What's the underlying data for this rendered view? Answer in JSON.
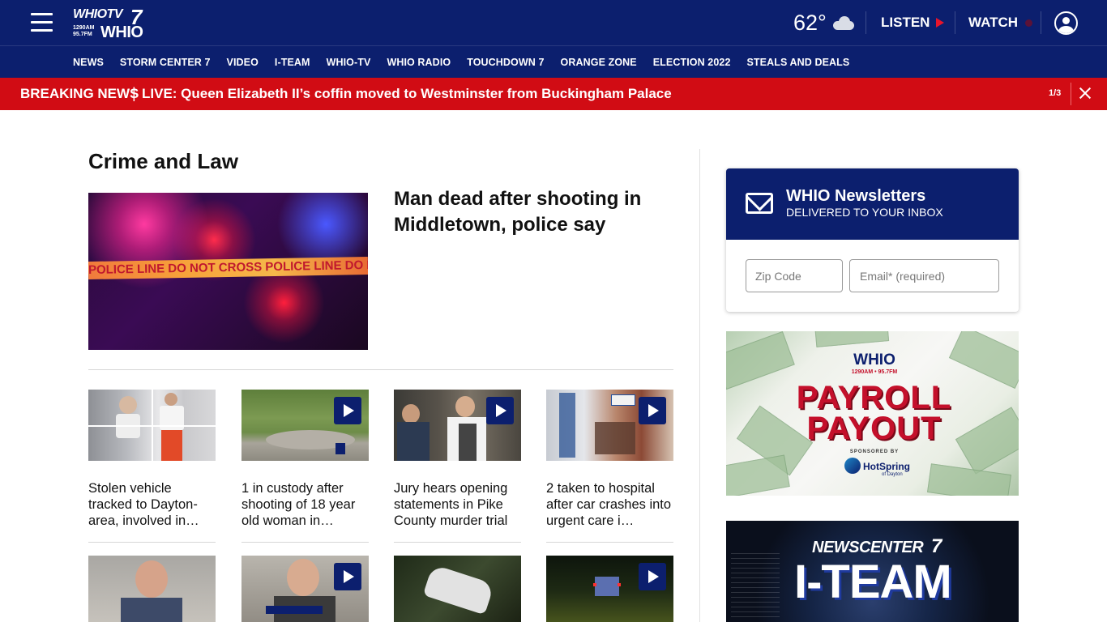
{
  "header": {
    "logo_line1": "WHIOTV",
    "logo_line1_num": "7",
    "logo_freq": "1290AM\n95.7FM",
    "logo_line2": "WHIO",
    "menu_icon": "hamburger-icon",
    "weather": {
      "temperature": "62°",
      "icon": "partly-cloudy-icon"
    },
    "listen_label": "LISTEN",
    "watch_label": "WATCH",
    "account_icon": "user-account-icon"
  },
  "nav": {
    "items": [
      "NEWS",
      "STORM CENTER 7",
      "VIDEO",
      "I-TEAM",
      "WHIO-TV",
      "WHIO RADIO",
      "TOUCHDOWN 7",
      "ORANGE ZONE",
      "ELECTION 2022",
      "STEALS AND DEALS"
    ]
  },
  "breaking": {
    "label": "BREAKING NEWS",
    "separator": "|",
    "headline": "LIVE: Queen Elizabeth II’s coffin moved to Westminster from Buckingham Palace",
    "counter": "1/3"
  },
  "section": {
    "title": "Crime and Law",
    "lead": {
      "title": "Man dead after shooting in Middletown, police say",
      "image_tape_text": "POLICE LINE DO NOT CROSS  POLICE LINE DO NOT CROSS"
    },
    "cards": [
      {
        "title": "Stolen vehicle tracked to Dayton-area, involved in…",
        "video": false
      },
      {
        "title": "1 in custody after shooting of 18 year old woman in…",
        "video": true
      },
      {
        "title": "Jury hears opening statements in Pike County murder trial",
        "video": true
      },
      {
        "title": "2 taken to hospital after car crashes into urgent care i…",
        "video": true
      },
      {
        "title": "",
        "video": false
      },
      {
        "title": "",
        "video": true
      },
      {
        "title": "",
        "video": false
      },
      {
        "title": "",
        "video": true
      }
    ]
  },
  "newsletter": {
    "title": "WHIO Newsletters",
    "subtitle": "DELIVERED TO YOUR INBOX",
    "zip_placeholder": "Zip Code",
    "email_placeholder": "Email* (required)"
  },
  "ads": {
    "payroll": {
      "brand": "WHIO",
      "brand_sub": "1290AM • 95.7FM",
      "line1": "PAYROLL",
      "line2": "PAYOUT",
      "sponsored": "SPONSORED BY",
      "sponsor": "HotSpring",
      "sponsor_sub": "of Dayton"
    },
    "iteam": {
      "line1": "NEWSCENTER",
      "line1_num": "7",
      "line2": "I-TEAM"
    }
  },
  "colors": {
    "brand_navy": "#0c1f6e",
    "breaking_red": "#d10c14",
    "play_red": "#e8142b"
  }
}
